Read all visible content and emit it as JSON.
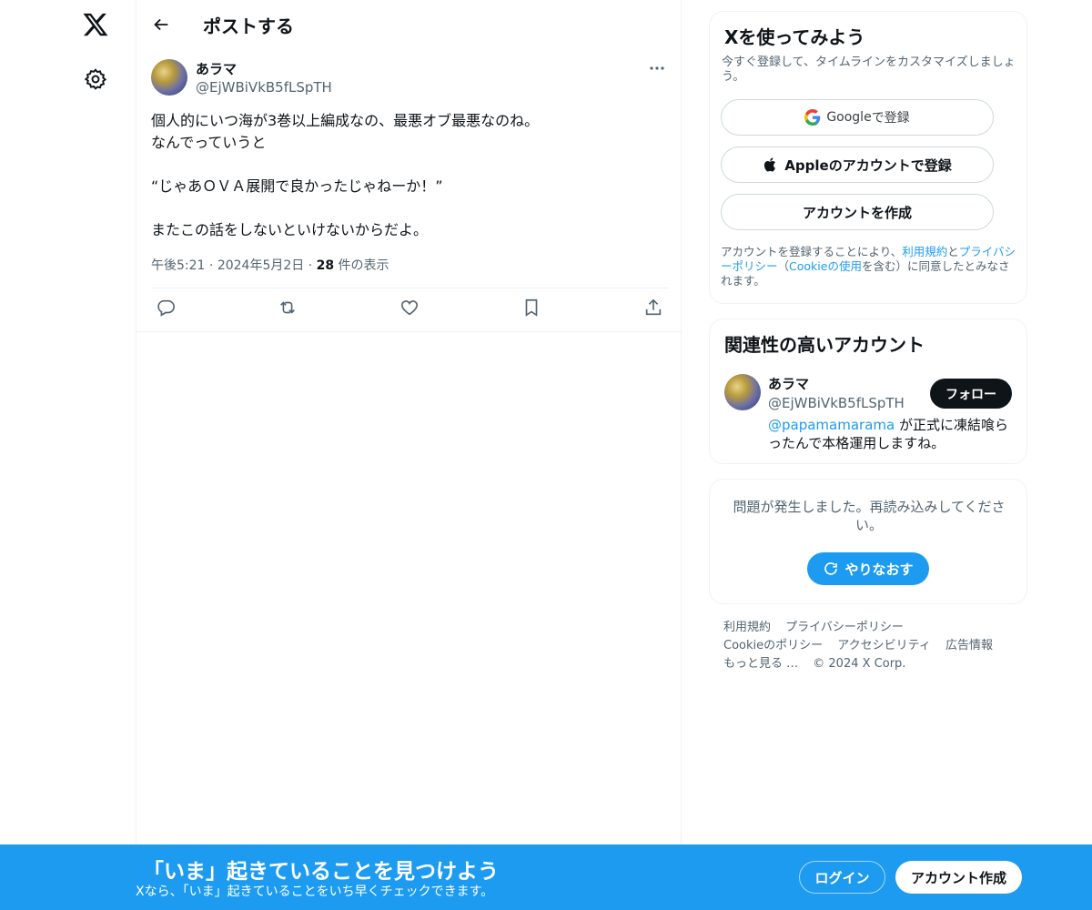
{
  "nav": {
    "logo_icon": "x-logo-icon",
    "settings_icon": "gear-icon"
  },
  "header": {
    "back_icon": "arrow-left-icon",
    "title": "ポストする"
  },
  "post": {
    "author_name": "あラマ",
    "author_handle": "@EjWBiVkB5fLSpTH",
    "more_icon": "more-horizontal-icon",
    "lines": [
      "個人的にいつ海が3巻以上編成なの、最悪オブ最悪なのね。",
      "なんでっていうと",
      "",
      "“じゃあＯＶＡ展開で良かったじゃねーか！”",
      "",
      "またこの話をしないといけないからだよ。"
    ],
    "time": "午後5:21",
    "sep": "·",
    "date": "2024年5月2日",
    "views_count": "28",
    "views_label": " 件の表示",
    "actions": [
      "reply-icon",
      "repost-icon",
      "like-icon",
      "bookmark-icon",
      "share-icon"
    ]
  },
  "signup_card": {
    "title": "Xを使ってみよう",
    "subtitle": "今すぐ登録して、タイムラインをカスタマイズしましょう。",
    "google_brand": "Google",
    "google_suffix": " で登録",
    "apple_label": "Appleのアカウントで登録",
    "create_label": "アカウントを作成",
    "legal_1": "アカウントを登録することにより、",
    "legal_terms": "利用規約",
    "legal_and": "と",
    "legal_privacy": "プライバシーポリシー",
    "legal_paren_open": "（",
    "legal_cookie": "Cookieの使用",
    "legal_2": "を含む）に同意したとみなされます。"
  },
  "related_card": {
    "title": "関連性の高いアカウント",
    "name": "あラマ",
    "handle": "@EjWBiVkB5fLSpTH",
    "follow_label": "フォロー",
    "bio_mention": "@papamamarama",
    "bio_text": " が正式に凍結喰らったんで本格運用しますね。"
  },
  "error_card": {
    "message": "問題が発生しました。再読み込みしてください。",
    "retry_label": "やりなおす"
  },
  "footer": {
    "links": [
      "利用規約",
      "プライバシーポリシー",
      "Cookieのポリシー",
      "アクセシビリティ",
      "広告情報",
      "もっと見る …",
      "© 2024 X Corp."
    ]
  },
  "banner": {
    "title": "「いま」起きていることを見つけよう",
    "subtitle": "Xなら、「いま」起きていることをいち早くチェックできます。",
    "login_label": "ログイン",
    "signup_label": "アカウント作成"
  },
  "colors": {
    "accent": "#1d9bf0",
    "text": "#0f1419",
    "muted": "#536471",
    "border": "#eff3f4"
  }
}
